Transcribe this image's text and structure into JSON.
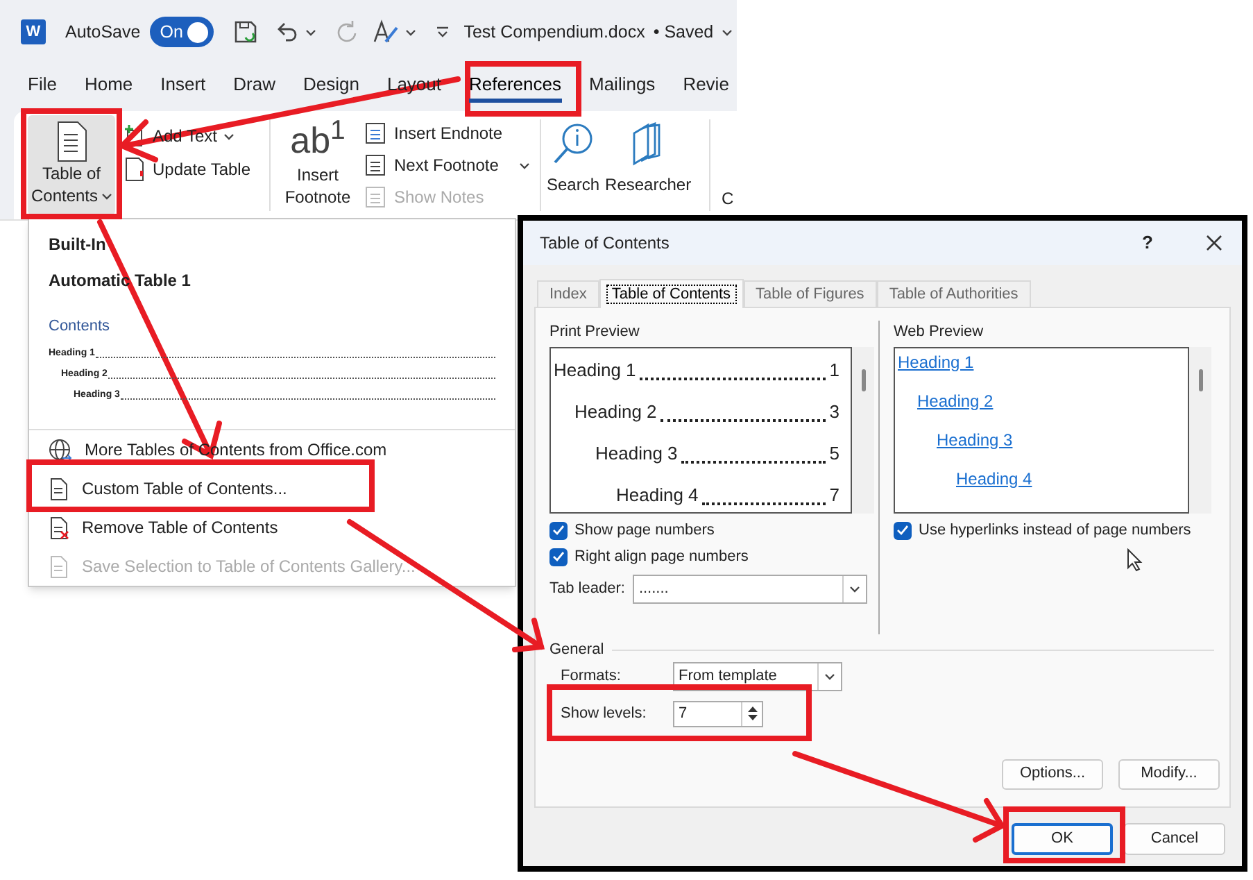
{
  "title_bar": {
    "app_letter": "W",
    "autosave_label": "AutoSave",
    "autosave": {
      "label": "On",
      "on": true
    },
    "document_title": "Test Compendium.docx",
    "save_status": "• Saved"
  },
  "ribbon_tabs": [
    {
      "label": "File",
      "selected": false
    },
    {
      "label": "Home",
      "selected": false
    },
    {
      "label": "Insert",
      "selected": false
    },
    {
      "label": "Draw",
      "selected": false
    },
    {
      "label": "Design",
      "selected": false
    },
    {
      "label": "Layout",
      "selected": false
    },
    {
      "label": "References",
      "selected": true
    },
    {
      "label": "Mailings",
      "selected": false
    },
    {
      "label": "Revie",
      "selected": false
    }
  ],
  "ribbon": {
    "toc_button": {
      "lines": [
        "Table of",
        "Contents"
      ],
      "pressed": true
    },
    "small_buttons": [
      {
        "label": "Add Text",
        "disabled": false
      },
      {
        "label": "Update Table",
        "disabled": false
      }
    ],
    "footnote_button": {
      "icon_text": "ab$^{1}$",
      "lines": [
        "Insert",
        "Footnote"
      ]
    },
    "footnote_buttons": [
      {
        "label": "Insert Endnote",
        "disabled": false
      },
      {
        "label": "Next Footnote",
        "disabled": false
      },
      {
        "label": "Show Notes",
        "disabled": true
      }
    ],
    "research_buttons": [
      "Search",
      "Researcher"
    ],
    "cut_group_label": "C"
  },
  "toc_menu": {
    "section_header": "Built-In",
    "gallery_item": {
      "title": "Automatic Table 1",
      "preview_title": "Contents",
      "preview_entries": [
        "Heading 1",
        "Heading 2",
        "Heading 3"
      ]
    },
    "items": [
      {
        "label": "More Tables of Contents from Office.com",
        "disabled": false
      },
      {
        "label": "Custom Table of Contents...",
        "disabled": false
      },
      {
        "label": "Remove Table of Contents",
        "disabled": false
      },
      {
        "label": "Save Selection to Table of Contents Gallery...",
        "disabled": true
      }
    ]
  },
  "dialog": {
    "title": "Table of Contents",
    "help": "?",
    "tabs": [
      {
        "label": "Index",
        "selected": false
      },
      {
        "label": "Table of Contents",
        "selected": true
      },
      {
        "label": "Table of Figures",
        "selected": false
      },
      {
        "label": "Table of Authorities",
        "selected": false
      }
    ],
    "print_preview": {
      "label": "Print Preview",
      "entries": [
        {
          "text": "Heading 1",
          "page": "1"
        },
        {
          "text": "Heading 2",
          "page": "3"
        },
        {
          "text": "Heading 3",
          "page": "5"
        },
        {
          "text": "Heading 4",
          "page": "7"
        }
      ]
    },
    "print_options": [
      {
        "label": "Show page numbers",
        "checked": true
      },
      {
        "label": "Right align page numbers",
        "checked": true
      }
    ],
    "tab_leader": {
      "label": "Tab leader:",
      "value": "......."
    },
    "web_preview": {
      "label": "Web Preview",
      "entries": [
        "Heading 1",
        "Heading 2",
        "Heading 3",
        "Heading 4"
      ]
    },
    "web_options": [
      {
        "label": "Use hyperlinks instead of page numbers",
        "checked": true
      }
    ],
    "general": {
      "label": "General",
      "formats": {
        "label": "Formats:",
        "value": "From template"
      },
      "show_levels": {
        "label": "Show levels:",
        "value": "7"
      }
    },
    "panel_buttons": [
      "Options...",
      "Modify..."
    ],
    "footer_buttons": [
      {
        "label": "OK",
        "default": true
      },
      {
        "label": "Cancel",
        "default": false
      }
    ]
  }
}
